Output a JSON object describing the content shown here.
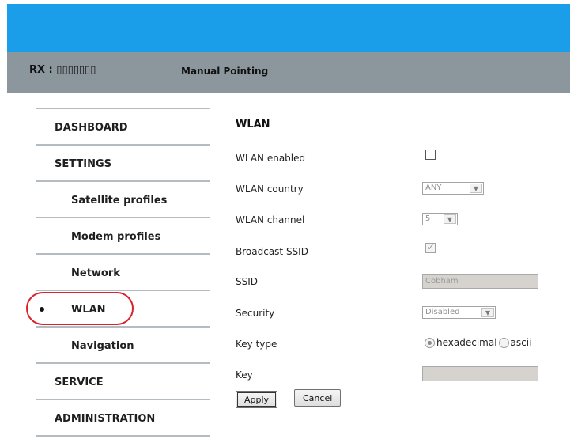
{
  "header": {
    "rx_label": "RX : ▯▯▯▯▯▯▯",
    "page_name": "Manual Pointing"
  },
  "sidebar": {
    "items": [
      {
        "label": "DASHBOARD",
        "level": "top",
        "active": false
      },
      {
        "label": "SETTINGS",
        "level": "top",
        "active": false
      },
      {
        "label": "Satellite profiles",
        "level": "sub",
        "active": false
      },
      {
        "label": "Modem profiles",
        "level": "sub",
        "active": false
      },
      {
        "label": "Network",
        "level": "sub",
        "active": false
      },
      {
        "label": "WLAN",
        "level": "sub",
        "active": true
      },
      {
        "label": "Navigation",
        "level": "sub",
        "active": false
      },
      {
        "label": "SERVICE",
        "level": "top",
        "active": false
      },
      {
        "label": "ADMINISTRATION",
        "level": "top",
        "active": false
      }
    ]
  },
  "form": {
    "title": "WLAN",
    "wlan_enabled": {
      "label": "WLAN enabled",
      "checked": false
    },
    "wlan_country": {
      "label": "WLAN country",
      "value": "ANY"
    },
    "wlan_channel": {
      "label": "WLAN channel",
      "value": "5"
    },
    "broadcast_ssid": {
      "label": "Broadcast SSID",
      "checked": true,
      "check_glyph": "✓"
    },
    "ssid": {
      "label": "SSID",
      "value": "Cobham"
    },
    "security": {
      "label": "Security",
      "value": "Disabled"
    },
    "key_type": {
      "label": "Key type",
      "options": [
        "hexadecimal",
        "ascii"
      ],
      "selected": "hexadecimal"
    },
    "key": {
      "label": "Key",
      "value": ""
    },
    "apply_label": "Apply",
    "cancel_label": "Cancel"
  },
  "colors": {
    "top_bar": "#1a9eea",
    "sub_bar": "#8c979d",
    "highlight_ring": "#d9232a"
  }
}
